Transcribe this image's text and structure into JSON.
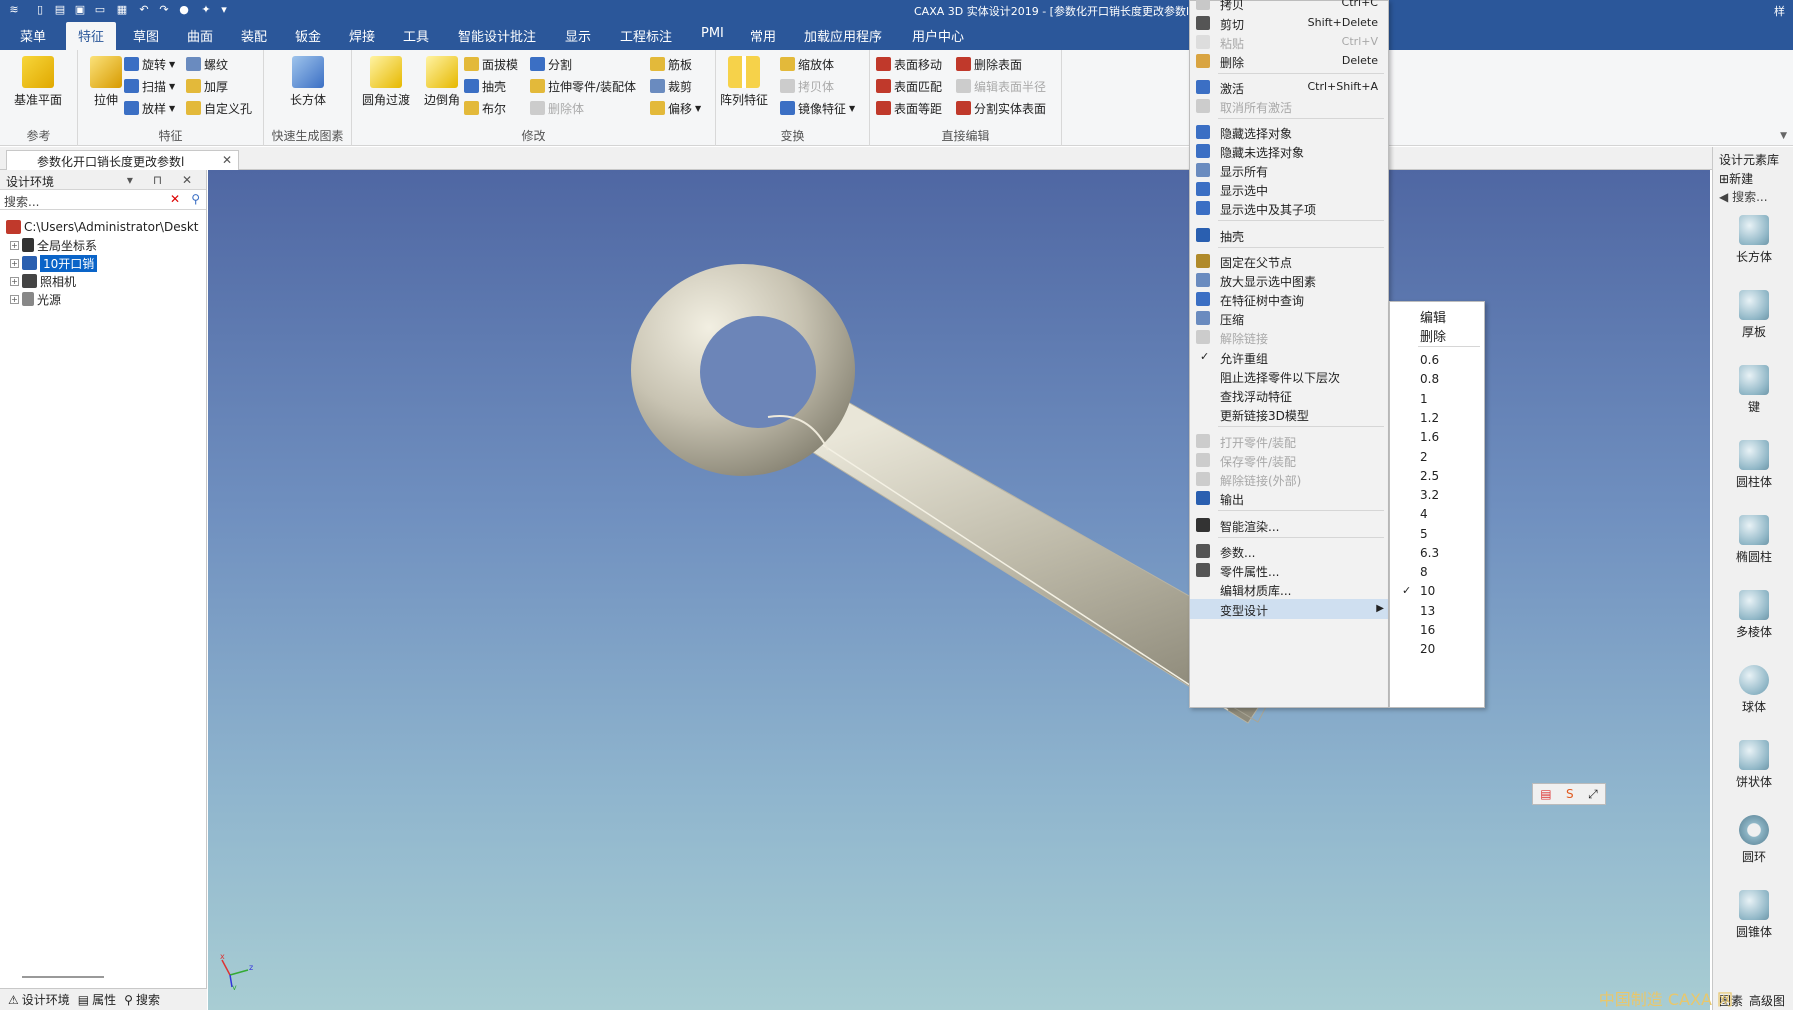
{
  "app": {
    "title": "CAXA 3D 实体设计2019 - [参数化开口销长度更改参数l",
    "title_right": "样",
    "quick_access": [
      "new-icon",
      "open-icon",
      "save-icon",
      "undo-icon",
      "redo-icon",
      "render-icon",
      "customize-icon"
    ]
  },
  "menu_tabs": [
    "菜单",
    "特征",
    "草图",
    "曲面",
    "装配",
    "钣金",
    "焊接",
    "工具",
    "智能设计批注",
    "显示",
    "工程标注",
    "PMI",
    "常用",
    "加载应用程序",
    "用户中心"
  ],
  "active_tab": "特征",
  "ribbon": {
    "groups": {
      "reference": {
        "label": "参考",
        "datum_plane": "基准平面"
      },
      "feature": {
        "label": "特征",
        "extrude": "拉伸",
        "revolve": "旋转",
        "sweep": "扫描",
        "loft": "放样",
        "thread": "螺纹",
        "thicken": "加厚",
        "custom_hole": "自定义孔"
      },
      "quick": {
        "label": "快速生成图素",
        "box": "长方体"
      },
      "modify": {
        "label": "修改",
        "fillet": "圆角过渡",
        "chamfer": "边倒角",
        "draft": "面拔模",
        "shell": "抽壳",
        "boolean": "布尔",
        "split": "分割",
        "stretch": "拉伸零件/装配体",
        "delete_body": "删除体",
        "rib": "筋板",
        "trim": "裁剪",
        "offset": "偏移"
      },
      "transform": {
        "label": "变换",
        "pattern": "阵列特征",
        "scale": "缩放体",
        "copy": "拷贝体",
        "mirror": "镜像特征"
      },
      "direct_edit": {
        "label": "直接编辑",
        "move_face": "表面移动",
        "match_face": "表面匹配",
        "offset_face": "表面等距",
        "delete_face": "删除表面",
        "edit_radius": "编辑表面半径",
        "split_solid_face": "分割实体表面"
      }
    }
  },
  "doc_tab": {
    "title": "参数化开口销长度更改参数l",
    "close": "✕"
  },
  "left_panel": {
    "title": "设计环境",
    "search_placeholder": "搜索...",
    "path": "C:\\Users\\Administrator\\Deskt",
    "tree": [
      "全局坐标系",
      "10开口销",
      "照相机",
      "光源"
    ],
    "bottom_tabs": [
      "设计环境",
      "属性",
      "搜索"
    ]
  },
  "right_panel": {
    "title": "设计元素库",
    "new_label": "新建",
    "search_placeholder": "搜索...",
    "items": [
      "长方体",
      "厚板",
      "键",
      "圆柱体",
      "椭圆柱",
      "多棱体",
      "球体",
      "饼状体",
      "圆环",
      "圆锥体"
    ],
    "bottom_tabs": [
      "图素",
      "高级图"
    ]
  },
  "context_menu": {
    "items": [
      {
        "label": "拷贝",
        "shortcut": "Ctrl+C",
        "enabled": true
      },
      {
        "label": "剪切",
        "shortcut": "Shift+Delete",
        "enabled": true
      },
      {
        "label": "粘贴",
        "shortcut": "Ctrl+V",
        "enabled": false
      },
      {
        "label": "删除",
        "shortcut": "Delete",
        "enabled": true
      },
      {
        "label": "激活",
        "shortcut": "Ctrl+Shift+A",
        "enabled": true
      },
      {
        "label": "取消所有激活",
        "shortcut": "",
        "enabled": false
      },
      {
        "label": "隐藏选择对象",
        "shortcut": "",
        "enabled": true
      },
      {
        "label": "隐藏未选择对象",
        "shortcut": "",
        "enabled": true
      },
      {
        "label": "显示所有",
        "shortcut": "",
        "enabled": true
      },
      {
        "label": "显示选中",
        "shortcut": "",
        "enabled": true
      },
      {
        "label": "显示选中及其子项",
        "shortcut": "",
        "enabled": true
      },
      {
        "label": "抽壳",
        "shortcut": "",
        "enabled": true
      },
      {
        "label": "固定在父节点",
        "shortcut": "",
        "enabled": true
      },
      {
        "label": "放大显示选中图素",
        "shortcut": "",
        "enabled": true
      },
      {
        "label": "在特征树中查询",
        "shortcut": "",
        "enabled": true
      },
      {
        "label": "压缩",
        "shortcut": "",
        "enabled": true
      },
      {
        "label": "解除链接",
        "shortcut": "",
        "enabled": false
      },
      {
        "label": "允许重组",
        "shortcut": "",
        "enabled": true,
        "checked": true
      },
      {
        "label": "阻止选择零件以下层次",
        "shortcut": "",
        "enabled": true
      },
      {
        "label": "查找浮动特征",
        "shortcut": "",
        "enabled": true
      },
      {
        "label": "更新链接3D模型",
        "shortcut": "",
        "enabled": true
      },
      {
        "label": "打开零件/装配",
        "shortcut": "",
        "enabled": false
      },
      {
        "label": "保存零件/装配",
        "shortcut": "",
        "enabled": false
      },
      {
        "label": "解除链接(外部)",
        "shortcut": "",
        "enabled": false
      },
      {
        "label": "输出",
        "shortcut": "",
        "enabled": true
      },
      {
        "label": "智能渲染...",
        "shortcut": "",
        "enabled": true
      },
      {
        "label": "参数...",
        "shortcut": "",
        "enabled": true
      },
      {
        "label": "零件属性...",
        "shortcut": "",
        "enabled": true
      },
      {
        "label": "编辑材质库...",
        "shortcut": "",
        "enabled": true
      },
      {
        "label": "变型设计",
        "shortcut": "",
        "enabled": true,
        "submenu": true
      }
    ]
  },
  "submenu": {
    "actions": [
      "编辑",
      "删除"
    ],
    "sizes": [
      "0.6",
      "0.8",
      "1",
      "1.2",
      "1.6",
      "2",
      "2.5",
      "3.2",
      "4",
      "5",
      "6.3",
      "8",
      "10",
      "13",
      "16",
      "20"
    ],
    "checked": "10"
  },
  "colors": {
    "title_bar": "#2b579a",
    "viewport_top": "#4f67a3",
    "viewport_bottom": "#a8cdd3",
    "model": "#c3bfaf",
    "selection": "#0a64c8"
  },
  "watermark": "中国制造   CAXA   网"
}
